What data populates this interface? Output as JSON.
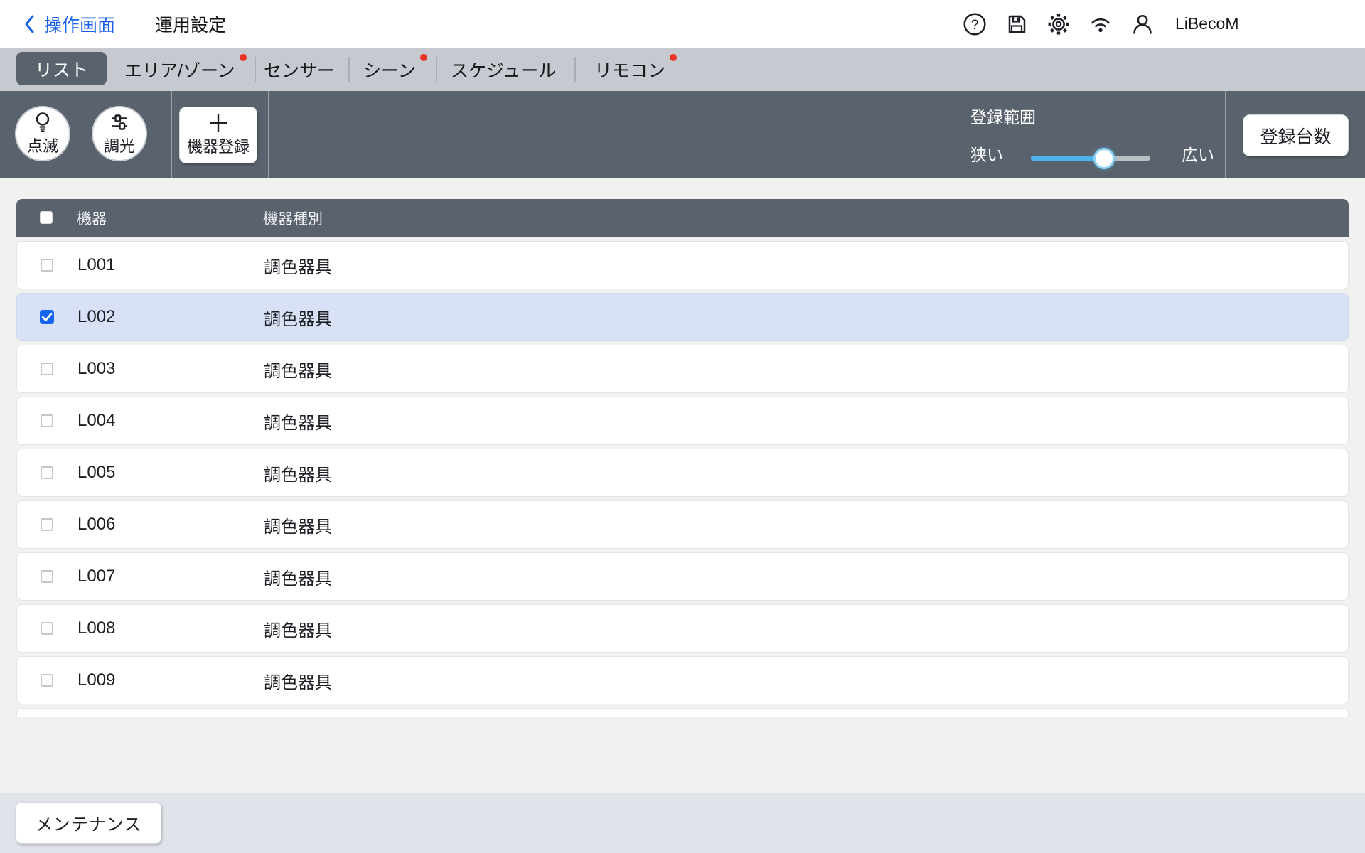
{
  "header": {
    "back_label": "操作画面",
    "title": "運用設定",
    "user_label": "LiBecoM",
    "icons": [
      "help-icon",
      "save-icon",
      "settings-icon",
      "wifi-icon",
      "user-icon"
    ]
  },
  "tabs": {
    "items": [
      {
        "label": "リスト",
        "selected": true,
        "badge": false
      },
      {
        "label": "エリア/ゾーン",
        "selected": false,
        "badge": true
      },
      {
        "label": "センサー",
        "selected": false,
        "badge": false
      },
      {
        "label": "シーン",
        "selected": false,
        "badge": true
      },
      {
        "label": "スケジュール",
        "selected": false,
        "badge": false
      },
      {
        "label": "リモコン",
        "selected": false,
        "badge": true
      }
    ]
  },
  "toolbar": {
    "blink_label": "点滅",
    "dim_label": "調光",
    "register_label": "機器登録",
    "range": {
      "title": "登録範囲",
      "narrow_label": "狭い",
      "wide_label": "広い",
      "value_percent": 60
    },
    "count_button_label": "登録台数"
  },
  "table": {
    "columns": [
      "機器",
      "機器種別"
    ],
    "rows": [
      {
        "device": "L001",
        "type": "調色器具",
        "checked": false
      },
      {
        "device": "L002",
        "type": "調色器具",
        "checked": true
      },
      {
        "device": "L003",
        "type": "調色器具",
        "checked": false
      },
      {
        "device": "L004",
        "type": "調色器具",
        "checked": false
      },
      {
        "device": "L005",
        "type": "調色器具",
        "checked": false
      },
      {
        "device": "L006",
        "type": "調色器具",
        "checked": false
      },
      {
        "device": "L007",
        "type": "調色器具",
        "checked": false
      },
      {
        "device": "L008",
        "type": "調色器具",
        "checked": false
      },
      {
        "device": "L009",
        "type": "調色器具",
        "checked": false
      }
    ]
  },
  "footer": {
    "maintenance_label": "メンテナンス"
  },
  "colors": {
    "dark_slate": "#5a626e",
    "tabbar_bg": "#c6c9cf",
    "accent_blue": "#1961e8",
    "checkbox_blue": "#1566ee",
    "slider_blue": "#4db3ec",
    "selected_row_bg": "#d8e1f6",
    "badge_red": "#e93425",
    "bottombar_bg": "#e1e3eb"
  }
}
